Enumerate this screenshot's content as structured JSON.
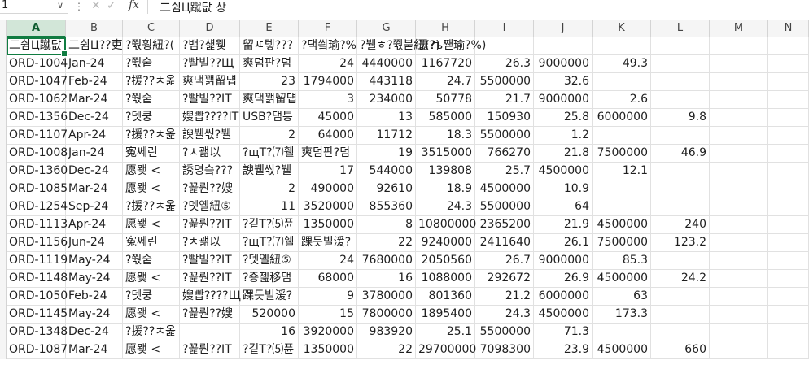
{
  "formula_bar": {
    "name_box": "1",
    "fx_label": "fx",
    "content": "二쉼Ц蹴닶 상"
  },
  "columns": [
    "A",
    "B",
    "C",
    "D",
    "E",
    "F",
    "G",
    "H",
    "I",
    "J",
    "K",
    "L",
    "M",
    "N"
  ],
  "header_row": [
    "二쉼Ц蹴닶",
    "二쉼Ц??吏",
    "?쭧훵紐?(",
    "?뱀?섍웾",
    "留ㅼ텧???",
    "?댁씤瑜?%",
    "?뷀ㅎ?쭧붇紐(?)",
    "뭃?ъ쨷瑜?%)",
    "",
    "",
    "",
    "",
    "",
    ""
  ],
  "rows": [
    [
      "ORD-1004",
      "Jan-24",
      "?쭧숱",
      "?빨빌??Щ",
      "爽덤판?덤",
      "24",
      "4440000",
      "1167720",
      "26.3",
      "9000000",
      "49.3",
      "",
      ""
    ],
    [
      "ORD-1047",
      "Feb-24",
      "?援??ㅊ옱",
      "爽댁꽭留덉",
      "23",
      "1794000",
      "443118",
      "24.7",
      "5500000",
      "32.6",
      "",
      "",
      ""
    ],
    [
      "ORD-1062",
      "Mar-24",
      "?쭧숱",
      "?빨빌??IT",
      "爽댁꽭留덉",
      "3",
      "234000",
      "50778",
      "21.7",
      "9000000",
      "2.6",
      "",
      ""
    ],
    [
      "ORD-1356",
      "Dec-24",
      "?뎃쿵",
      "嫂빱????IT",
      "USB?댐틍",
      "45000",
      "13",
      "585000",
      "150930",
      "25.8",
      "6000000",
      "9.8",
      ""
    ],
    [
      "ORD-1107",
      "Apr-24",
      "?援??ㅊ옱",
      "諛뷀씫?뷀",
      "2",
      "64000",
      "11712",
      "18.3",
      "5500000",
      "1.2",
      "",
      "",
      ""
    ],
    [
      "ORD-1008",
      "Jan-24",
      "寃쎄린",
      "?ㅊ괢以",
      "?щT?⑺휄",
      "爽덤판?덤",
      "19",
      "3515000",
      "766270",
      "21.8",
      "7500000",
      "46.9",
      ""
    ],
    [
      "ORD-1360",
      "Dec-24",
      "愿뫶 <",
      "誘명슼???",
      "諛뷀씫?뷀",
      "17",
      "544000",
      "139808",
      "25.7",
      "4500000",
      "12.1",
      "",
      ""
    ],
    [
      "ORD-1085",
      "Mar-24",
      "愿뫶 <",
      "?꾩뤈??嫂",
      "2",
      "490000",
      "92610",
      "18.9",
      "4500000",
      "10.9",
      "",
      "",
      ""
    ],
    [
      "ORD-1254",
      "Sep-24",
      "?援??ㅊ옱",
      "?뎃옐紐⑤",
      "11",
      "3520000",
      "855360",
      "24.3",
      "5500000",
      "64",
      "",
      "",
      ""
    ],
    [
      "ORD-1113",
      "Apr-24",
      "愿뫶 <",
      "?꾩뤈??IT",
      "?깉T?⑸퓬",
      "1350000",
      "8",
      "10800000",
      "2365200",
      "21.9",
      "4500000",
      "240",
      ""
    ],
    [
      "ORD-1156",
      "Jun-24",
      "寃쎄린",
      "?ㅊ괢以",
      "?щT?⑺휄",
      "踝듯빌湲?",
      "22",
      "9240000",
      "2411640",
      "26.1",
      "7500000",
      "123.2",
      ""
    ],
    [
      "ORD-1119",
      "May-24",
      "?쭧숱",
      "?빨빌??IT",
      "?뎃옐紐⑤",
      "24",
      "7680000",
      "2050560",
      "26.7",
      "9000000",
      "85.3",
      "",
      ""
    ],
    [
      "ORD-1148",
      "May-24",
      "愿뫶 <",
      "?꾩뤈??IT",
      "?죵젪移댐",
      "68000",
      "16",
      "1088000",
      "292672",
      "26.9",
      "4500000",
      "24.2",
      ""
    ],
    [
      "ORD-1050",
      "Feb-24",
      "?뎃쿵",
      "嫂빱????Щ",
      "踝듯빌湲?",
      "9",
      "3780000",
      "801360",
      "21.2",
      "6000000",
      "63",
      "",
      ""
    ],
    [
      "ORD-1145",
      "May-24",
      "愿뫶 <",
      "?꾩뤈??嫂",
      "520000",
      "15",
      "7800000",
      "1895400",
      "24.3",
      "4500000",
      "173.3",
      "",
      ""
    ],
    [
      "ORD-1348",
      "Dec-24",
      "?援??ㅊ옱",
      "",
      "16",
      "3920000",
      "983920",
      "25.1",
      "5500000",
      "71.3",
      "",
      "",
      ""
    ],
    [
      "ORD-1087",
      "Mar-24",
      "愿뫶 <",
      "?꾩뤈??IT",
      "?깉T?⑸퓬",
      "1350000",
      "22",
      "29700000",
      "7098300",
      "23.9",
      "4500000",
      "660",
      ""
    ]
  ]
}
